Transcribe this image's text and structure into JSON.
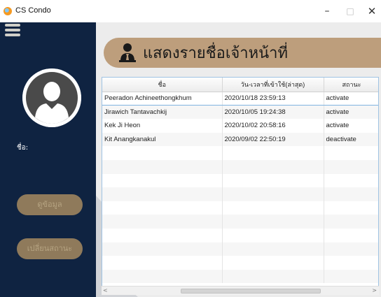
{
  "window": {
    "title": "CS Condo",
    "minimize_glyph": "–",
    "maximize_glyph": "□",
    "close_glyph": "✕"
  },
  "sidebar": {
    "name_label": "ชื่อ:",
    "view_button": "ดูข้อมูล",
    "change_status_button": "เปลี่ยนสถานะ"
  },
  "header": {
    "title": "แสดงรายชื่อเจ้าหน้าที่",
    "icon": "user-tie-icon"
  },
  "table": {
    "columns": [
      "ชื่อ",
      "วัน-เวลาที่เข้าใช้(ล่าสุด)",
      "สถานะ"
    ],
    "rows": [
      {
        "name": "Peeradon Achineethongkhum",
        "last_login": "2020/10/18 23:59:13",
        "status": "activate"
      },
      {
        "name": "Jirawich Tantavachkij",
        "last_login": "2020/10/05 19:24:38",
        "status": "activate"
      },
      {
        "name": "Kek Ji Heon",
        "last_login": "2020/10/02 20:58:16",
        "status": "activate"
      },
      {
        "name": "Kit Anangkanakul",
        "last_login": "2020/09/02 22:50:19",
        "status": "deactivate"
      }
    ],
    "empty_rows": 10
  },
  "colors": {
    "sidebar": "#0f2341",
    "accent": "#bd9e7c",
    "button": "#8f7a5b"
  }
}
